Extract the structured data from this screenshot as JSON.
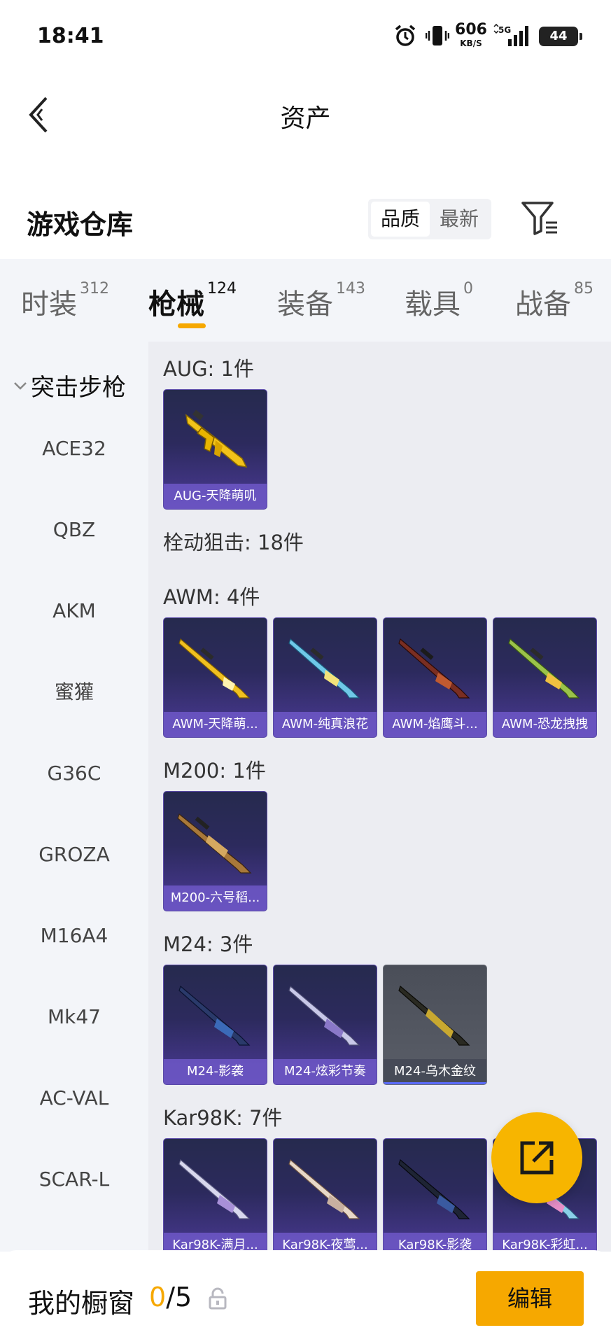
{
  "status_bar": {
    "time": "18:41",
    "net_speed": "606",
    "net_unit": "KB/S",
    "network": "5G",
    "battery": "44"
  },
  "nav": {
    "title": "资产"
  },
  "section": {
    "title": "游戏仓库",
    "sort_options": [
      "品质",
      "最新"
    ]
  },
  "tabs": [
    {
      "label": "时装",
      "count": "312"
    },
    {
      "label": "枪械",
      "count": "124"
    },
    {
      "label": "装备",
      "count": "143"
    },
    {
      "label": "载具",
      "count": "0"
    },
    {
      "label": "战备",
      "count": "85"
    }
  ],
  "sidebar": {
    "group": "突击步枪",
    "items": [
      "ACE32",
      "QBZ",
      "AKM",
      "蜜獾",
      "G36C",
      "GROZA",
      "M16A4",
      "Mk47",
      "AC-VAL",
      "SCAR-L"
    ]
  },
  "content": {
    "groups": [
      {
        "header": "AUG: 1件",
        "items": [
          "AUG-天降萌叽"
        ]
      },
      {
        "header": "栓动狙击: 18件",
        "items": []
      },
      {
        "header": "AWM: 4件",
        "items": [
          "AWM-天降萌...",
          "AWM-纯真浪花",
          "AWM-焰鹰斗...",
          "AWM-恐龙拽拽"
        ]
      },
      {
        "header": "M200: 1件",
        "items": [
          "M200-六号稻..."
        ]
      },
      {
        "header": "M24: 3件",
        "items": [
          "M24-影袭",
          "M24-炫彩节奏",
          "M24-乌木金纹"
        ]
      },
      {
        "header": "Kar98K: 7件",
        "items": [
          "Kar98K-满月...",
          "Kar98K-夜莺...",
          "Kar98K-影袭",
          "Kar98K-彩虹..."
        ]
      }
    ]
  },
  "bottom": {
    "label": "我的橱窗",
    "current": "0",
    "total": "/5",
    "edit": "编辑"
  },
  "colors": {
    "accent": "#f6a800",
    "card_purple": "#4b3a96"
  }
}
